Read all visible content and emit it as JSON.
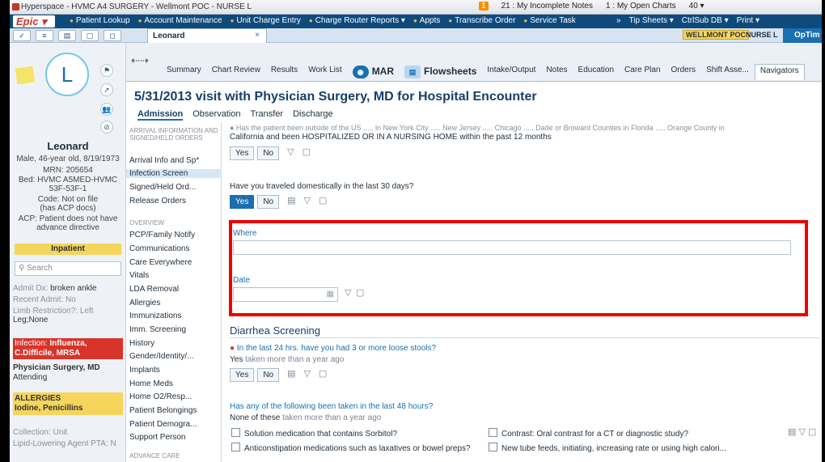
{
  "window": {
    "title": "Hyperspace - HVMC A4 SURGERY - Wellmont POC - NURSE L",
    "incomplete_count": "1",
    "incomplete_notes": "21 : My Incomplete Notes",
    "open_charts": "1 : My Open Charts",
    "msgs": "40 ▾"
  },
  "menubar": {
    "logo": "Epic ▾",
    "items": [
      "Patient Lookup",
      "Account Maintenance",
      "Unit Charge Entry",
      "Charge Router Reports ▾",
      "Appts",
      "Transcribe Order",
      "Service Task"
    ],
    "right": [
      "»",
      "Tip Sheets ▾",
      "CtrlSub DB ▾",
      "Print ▾"
    ]
  },
  "toolbar": {
    "patient_tab": "Leonard",
    "close": "×",
    "env": "WELLMONT POC",
    "user": "NURSE L",
    "optime": "OpTim"
  },
  "patient": {
    "initial": "L",
    "name": "Leonard",
    "demo": "Male, 46-year old, 8/19/1973",
    "mrn": "MRN: 205654",
    "bed1": "Bed: HVMC A5MED-HVMC",
    "bed2": "53F-53F-1",
    "code1": "Code: Not on file",
    "code2": "(has ACP docs)",
    "acp1": "ACP: Patient does not have",
    "acp2": "advance directive",
    "status": "Inpatient",
    "search": "Search",
    "admit_dx_label": "Admit Dx:",
    "admit_dx": "broken ankle",
    "recent_admit": "Recent Admit: No",
    "limb": "Limb Restriction?: Left",
    "limb2": "Leg;None",
    "infection_label": "Infection:",
    "infection": "Influenza,",
    "infection2": "C.Difficile, MRSA",
    "attending1": "Physician Surgery, MD",
    "attending2": "Attending",
    "allergies_label": "ALLERGIES",
    "allergies": "Iodine, Penicillins",
    "collection": "Collection: Unit",
    "lipid": "Lipid-Lowering Agent PTA: N"
  },
  "nav": {
    "tabs": [
      "Summary",
      "Chart Review",
      "Results",
      "Work List",
      "MAR",
      "Flowsheets",
      "Intake/Output",
      "Notes",
      "Education",
      "Care Plan",
      "Orders",
      "Shift Asse...",
      "Navigators"
    ],
    "title": "5/31/2013 visit with Physician Surgery, MD for Hospital Encounter",
    "subtabs": [
      "Admission",
      "Observation",
      "Transfer",
      "Discharge"
    ]
  },
  "leftnav": {
    "sec1": "ARRIVAL INFORMATION AND SIGNED/HELD ORDERS",
    "items1": [
      "Arrival Info and Sp*",
      "Infection Screen",
      "Signed/Held Ord...",
      "Release Orders"
    ],
    "sec2": "OVERVIEW",
    "items2": [
      "PCP/Family Notify",
      "Communications",
      "Care Everywhere",
      "Vitals",
      "LDA Removal",
      "Allergies",
      "Immunizations",
      "Imm. Screening",
      "History",
      "Gender/Identity/...",
      "Implants",
      "Home Meds",
      "Home O2/Resp...",
      "Patient Belongings",
      "Patient Demogra...",
      "Support Person"
    ],
    "sec3": "ADVANCE CARE"
  },
  "content": {
    "q1a": "● Has the patient been outside of the US ..... in New York City ..... New Jersey ..... Chicago ..... Dade or Broward Counties in Florida ..... Orange County in",
    "q1b": "California and been HOSPITALIZED OR IN A NURSING HOME within the past 12 months",
    "yes": "Yes",
    "no": "No",
    "q2": "Have you traveled domestically in the last 30 days?",
    "where": "Where",
    "date": "Date",
    "diarrhea": "Diarrhea Screening",
    "q3": "In the last 24 hrs. have you had 3 or more loose stools?",
    "q3ans": "Yes",
    "q3when": "taken more than a year ago",
    "q4": "Has any of the following been taken in the last 48 hours?",
    "q4ans": "None of these",
    "q4when": "taken more than a year ago",
    "cb1": "Solution medication that contains Sorbitol?",
    "cb2": "Contrast: Oral contrast for a CT or diagnostic study?",
    "cb3": "Anticonstipation medications such as laxatives or bowel preps?",
    "cb4": "New tube feeds, initiating, increasing rate or using high calori..."
  },
  "colors": {
    "accent": "#1a6fb0",
    "menubar": "#0f4a7d",
    "highlight": "#e00000",
    "inpatient": "#f6d55c",
    "infection": "#d9342b"
  }
}
